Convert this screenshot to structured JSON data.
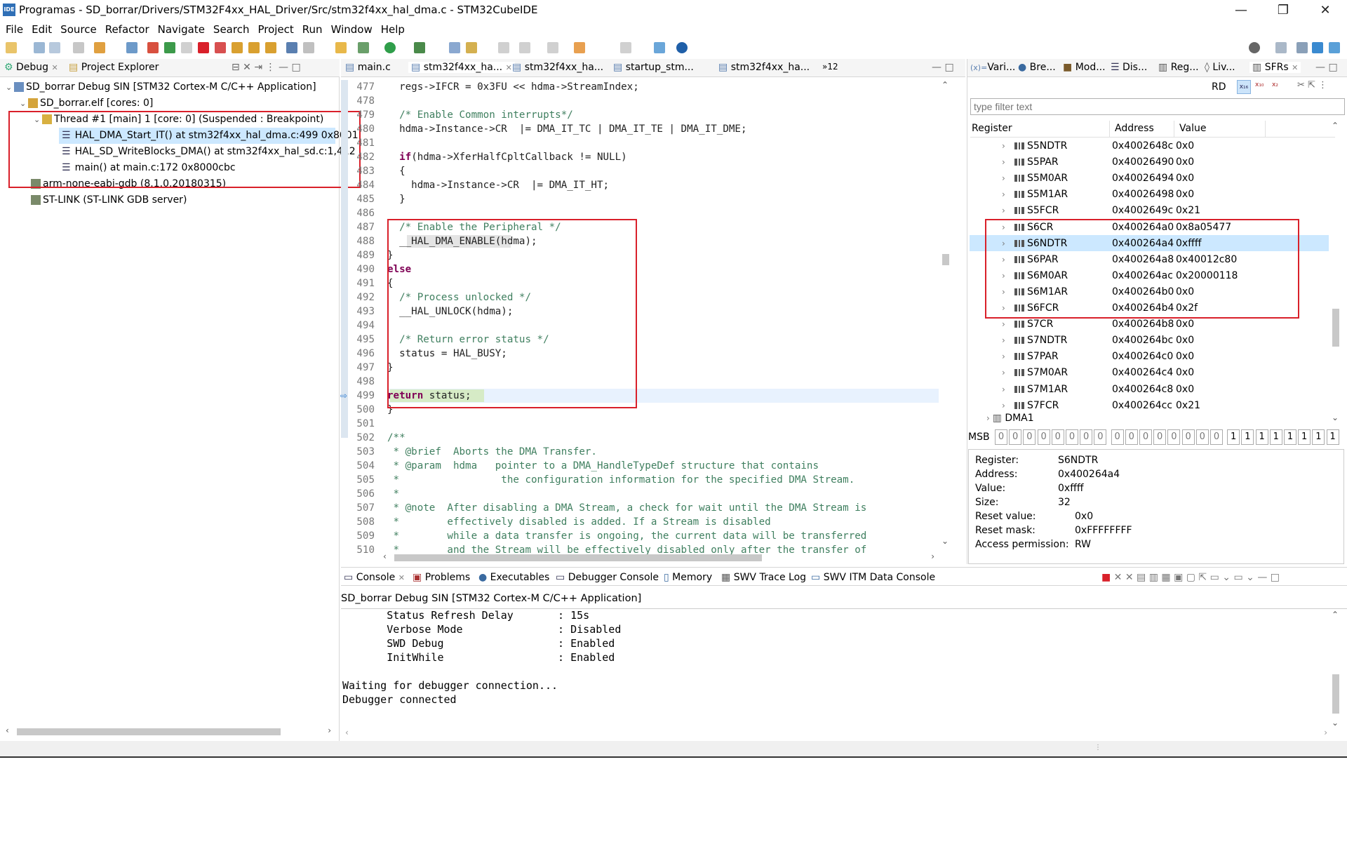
{
  "window": {
    "title": "Programas - SD_borrar/Drivers/STM32F4xx_HAL_Driver/Src/stm32f4xx_hal_dma.c - STM32CubeIDE",
    "app_icon_label": "IDE",
    "controls": [
      "—",
      "❐",
      "✕"
    ]
  },
  "menu": [
    "File",
    "Edit",
    "Source",
    "Refactor",
    "Navigate",
    "Search",
    "Project",
    "Run",
    "Window",
    "Help"
  ],
  "debug_view": {
    "tabs": [
      "Debug",
      "Project Explorer"
    ],
    "tree": [
      "SD_borrar Debug SIN [STM32 Cortex-M C/C++ Application]",
      "SD_borrar.elf [cores: 0]",
      "Thread #1 [main] 1 [core: 0] (Suspended : Breakpoint)",
      "HAL_DMA_Start_IT() at stm32f4xx_hal_dma.c:499 0x8001",
      "HAL_SD_WriteBlocks_DMA() at stm32f4xx_hal_sd.c:1,412",
      "main() at main.c:172 0x8000cbc",
      "arm-none-eabi-gdb (8.1.0.20180315)",
      "ST-LINK (ST-LINK GDB server)"
    ]
  },
  "editor": {
    "tabs": [
      "main.c",
      "stm32f4xx_ha...",
      "stm32f4xx_ha...",
      "startup_stm...",
      "stm32f4xx_ha...",
      "»12"
    ],
    "lines": [
      {
        "n": "477",
        "code": "  regs->IFCR = 0x3FU << hdma->StreamIndex;"
      },
      {
        "n": "478",
        "code": ""
      },
      {
        "n": "479",
        "code": "  /* Enable Common interrupts*/"
      },
      {
        "n": "480",
        "code": "  hdma->Instance->CR  |= DMA_IT_TC | DMA_IT_TE | DMA_IT_DME;"
      },
      {
        "n": "481",
        "code": ""
      },
      {
        "n": "482",
        "code": "  if(hdma->XferHalfCpltCallback != NULL)"
      },
      {
        "n": "483",
        "code": "  {"
      },
      {
        "n": "484",
        "code": "    hdma->Instance->CR  |= DMA_IT_HT;"
      },
      {
        "n": "485",
        "code": "  }"
      },
      {
        "n": "486",
        "code": ""
      },
      {
        "n": "487",
        "code": "  /* Enable the Peripheral */"
      },
      {
        "n": "488",
        "code": "  __HAL_DMA_ENABLE(hdma);"
      },
      {
        "n": "489",
        "code": "}"
      },
      {
        "n": "490",
        "code": "else"
      },
      {
        "n": "491",
        "code": "{"
      },
      {
        "n": "492",
        "code": "  /* Process unlocked */"
      },
      {
        "n": "493",
        "code": "  __HAL_UNLOCK(hdma);"
      },
      {
        "n": "494",
        "code": ""
      },
      {
        "n": "495",
        "code": "  /* Return error status */"
      },
      {
        "n": "496",
        "code": "  status = HAL_BUSY;"
      },
      {
        "n": "497",
        "code": "}"
      },
      {
        "n": "498",
        "code": ""
      },
      {
        "n": "499",
        "code": "return status;"
      },
      {
        "n": "500",
        "code": "}"
      },
      {
        "n": "501",
        "code": ""
      },
      {
        "n": "502",
        "code": "/**"
      },
      {
        "n": "503",
        "code": " * @brief  Aborts the DMA Transfer."
      },
      {
        "n": "504",
        "code": " * @param  hdma   pointer to a DMA_HandleTypeDef structure that contains"
      },
      {
        "n": "505",
        "code": " *                 the configuration information for the specified DMA Stream."
      },
      {
        "n": "506",
        "code": " *"
      },
      {
        "n": "507",
        "code": " * @note  After disabling a DMA Stream, a check for wait until the DMA Stream is"
      },
      {
        "n": "508",
        "code": " *        effectively disabled is added. If a Stream is disabled"
      },
      {
        "n": "509",
        "code": " *        while a data transfer is ongoing, the current data will be transferred"
      },
      {
        "n": "510",
        "code": " *        and the Stream will be effectively disabled only after the transfer of"
      }
    ]
  },
  "sfr_view": {
    "tabs": [
      "Vari...",
      "Bre...",
      "Mod...",
      "Dis...",
      "Reg...",
      "Liv...",
      "SFRs"
    ],
    "rd_label": "RD",
    "filter_placeholder": "type filter text",
    "columns": [
      "Register",
      "Address",
      "Value"
    ],
    "rows": [
      {
        "name": "S5NDTR",
        "address": "0x4002648c",
        "value": "0x0"
      },
      {
        "name": "S5PAR",
        "address": "0x40026490",
        "value": "0x0"
      },
      {
        "name": "S5M0AR",
        "address": "0x40026494",
        "value": "0x0"
      },
      {
        "name": "S5M1AR",
        "address": "0x40026498",
        "value": "0x0"
      },
      {
        "name": "S5FCR",
        "address": "0x4002649c",
        "value": "0x21"
      },
      {
        "name": "S6CR",
        "address": "0x400264a0",
        "value": "0x8a05477"
      },
      {
        "name": "S6NDTR",
        "address": "0x400264a4",
        "value": "0xffff"
      },
      {
        "name": "S6PAR",
        "address": "0x400264a8",
        "value": "0x40012c80"
      },
      {
        "name": "S6M0AR",
        "address": "0x400264ac",
        "value": "0x20000118"
      },
      {
        "name": "S6M1AR",
        "address": "0x400264b0",
        "value": "0x0"
      },
      {
        "name": "S6FCR",
        "address": "0x400264b4",
        "value": "0x2f"
      },
      {
        "name": "S7CR",
        "address": "0x400264b8",
        "value": "0x0"
      },
      {
        "name": "S7NDTR",
        "address": "0x400264bc",
        "value": "0x0"
      },
      {
        "name": "S7PAR",
        "address": "0x400264c0",
        "value": "0x0"
      },
      {
        "name": "S7M0AR",
        "address": "0x400264c4",
        "value": "0x0"
      },
      {
        "name": "S7M1AR",
        "address": "0x400264c8",
        "value": "0x0"
      },
      {
        "name": "S7FCR",
        "address": "0x400264cc",
        "value": "0x21"
      }
    ],
    "group_row": "DMA1",
    "msb_label": "MSB",
    "bits": [
      "0",
      "0",
      "0",
      "0",
      "0",
      "0",
      "0",
      "0",
      "0",
      "0",
      "0",
      "0",
      "0",
      "0",
      "0",
      "0",
      "1",
      "1",
      "1",
      "1",
      "1",
      "1",
      "1",
      "1"
    ],
    "details": [
      {
        "label": "Register:",
        "value": "S6NDTR"
      },
      {
        "label": "Address:",
        "value": "0x400264a4"
      },
      {
        "label": "Value:",
        "value": "0xffff"
      },
      {
        "label": "Size:",
        "value": "32"
      },
      {
        "label": "Reset value:",
        "value": "0x0"
      },
      {
        "label": "Reset mask:",
        "value": "0xFFFFFFFF"
      },
      {
        "label": "Access permission:",
        "value": "RW"
      }
    ]
  },
  "console": {
    "tabs": [
      "Console",
      "Problems",
      "Executables",
      "Debugger Console",
      "Memory",
      "SWV Trace Log",
      "SWV ITM Data Console"
    ],
    "header": "SD_borrar Debug SIN [STM32 Cortex-M C/C++ Application]",
    "lines": [
      "       Status Refresh Delay       : 15s",
      "       Verbose Mode               : Disabled",
      "       SWD Debug                  : Enabled",
      "       InitWhile                  : Enabled",
      "",
      "Waiting for debugger connection...",
      "Debugger connected"
    ]
  },
  "colors": {
    "highlight": "#cce8ff",
    "annotation": "#d9202a",
    "current_line": "#e8f2fe"
  }
}
